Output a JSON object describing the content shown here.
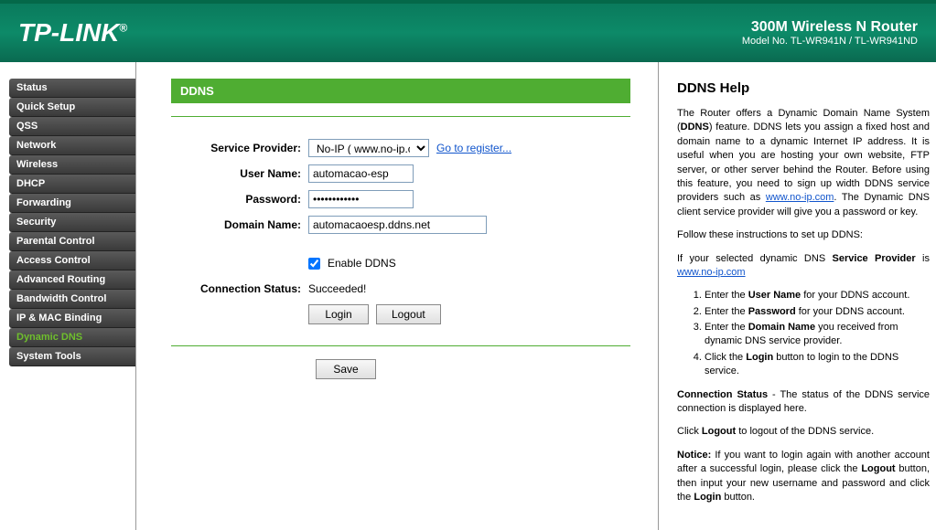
{
  "header": {
    "brand": "TP-LINK",
    "title_line1": "300M Wireless N Router",
    "title_line2": "Model No. TL-WR941N / TL-WR941ND"
  },
  "sidebar": {
    "items": [
      {
        "label": "Status",
        "active": false
      },
      {
        "label": "Quick Setup",
        "active": false
      },
      {
        "label": "QSS",
        "active": false
      },
      {
        "label": "Network",
        "active": false
      },
      {
        "label": "Wireless",
        "active": false
      },
      {
        "label": "DHCP",
        "active": false
      },
      {
        "label": "Forwarding",
        "active": false
      },
      {
        "label": "Security",
        "active": false
      },
      {
        "label": "Parental Control",
        "active": false
      },
      {
        "label": "Access Control",
        "active": false
      },
      {
        "label": "Advanced Routing",
        "active": false
      },
      {
        "label": "Bandwidth Control",
        "active": false
      },
      {
        "label": "IP & MAC Binding",
        "active": false
      },
      {
        "label": "Dynamic DNS",
        "active": true
      },
      {
        "label": "System Tools",
        "active": false
      }
    ]
  },
  "page": {
    "title": "DDNS",
    "labels": {
      "service_provider": "Service Provider:",
      "user_name": "User Name:",
      "password": "Password:",
      "domain_name": "Domain Name:",
      "enable_ddns": "Enable DDNS",
      "connection_status": "Connection Status:"
    },
    "values": {
      "service_provider": "No-IP ( www.no-ip.com )",
      "register_link": "Go to register...",
      "user_name": "automacao-esp",
      "password": "••••••••••••",
      "domain_name": "automacaoesp.ddns.net",
      "enable_ddns_checked": true,
      "connection_status": "Succeeded!"
    },
    "buttons": {
      "login": "Login",
      "logout": "Logout",
      "save": "Save"
    }
  },
  "help": {
    "title": "DDNS Help",
    "p1_pre": "The Router offers a Dynamic Domain Name System (",
    "p1_b1": "DDNS",
    "p1_mid1": ") feature. DDNS lets you assign a fixed host and domain name to a dynamic Internet IP address. It is useful when you are hosting your own website, FTP server, or other server behind the Router. Before using this feature, you need to sign up width DDNS service providers such as ",
    "p1_link": "www.no-ip.com",
    "p1_end": ". The Dynamic DNS client service provider will give you a password or key.",
    "p2": "Follow these instructions to set up DDNS:",
    "p3_pre": "If your selected dynamic DNS ",
    "p3_b": "Service Provider",
    "p3_mid": " is ",
    "p3_link": "www.no-ip.com",
    "ol": [
      {
        "pre": "Enter the ",
        "b": "User Name",
        "post": " for your DDNS account."
      },
      {
        "pre": "Enter the ",
        "b": "Password",
        "post": " for your DDNS account."
      },
      {
        "pre": "Enter the ",
        "b": "Domain Name",
        "post": " you received from dynamic DNS service provider."
      },
      {
        "pre": "Click the ",
        "b": "Login",
        "post": " button to login to the DDNS service."
      }
    ],
    "p4_b": "Connection Status",
    "p4_post": " - The status of the DDNS service connection is displayed here.",
    "p5_pre": "Click ",
    "p5_b": "Logout",
    "p5_post": " to logout of the DDNS service.",
    "p6_b1": "Notice:",
    "p6_mid1": "  If you want to login again with another account after a successful login, please click the ",
    "p6_b2": "Logout",
    "p6_mid2": " button, then input your new username and password and click the ",
    "p6_b3": "Login",
    "p6_post": " button."
  }
}
